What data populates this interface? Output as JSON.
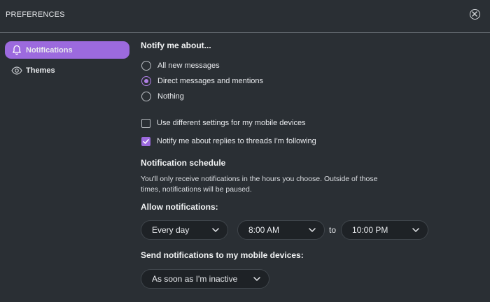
{
  "window": {
    "title": "PREFERENCES",
    "close_icon": "close-circle-icon"
  },
  "sidebar": {
    "items": [
      {
        "label": "Notifications",
        "icon": "bell-icon",
        "active": true
      },
      {
        "label": "Themes",
        "icon": "eye-icon",
        "active": false
      }
    ]
  },
  "notify": {
    "title": "Notify me about...",
    "options": [
      {
        "label": "All new messages",
        "selected": false
      },
      {
        "label": "Direct messages and mentions",
        "selected": true
      },
      {
        "label": "Nothing",
        "selected": false
      }
    ]
  },
  "checkboxes": [
    {
      "label": "Use different settings for my mobile devices",
      "checked": false
    },
    {
      "label": "Notify me about replies to threads I'm following",
      "checked": true
    }
  ],
  "schedule": {
    "title": "Notification schedule",
    "description": "You'll only receive notifications in the hours you choose. Outside of those times, notifications will be paused.",
    "allow_label": "Allow notifications:",
    "days": "Every day",
    "start_time": "8:00 AM",
    "to_label": "to",
    "end_time": "10:00 PM"
  },
  "mobile": {
    "title": "Send notifications to my mobile devices:",
    "value": "As soon as I'm inactive"
  },
  "colors": {
    "background": "#2a2f34",
    "accent": "#9c6ade",
    "select_bg": "#1e2226"
  }
}
